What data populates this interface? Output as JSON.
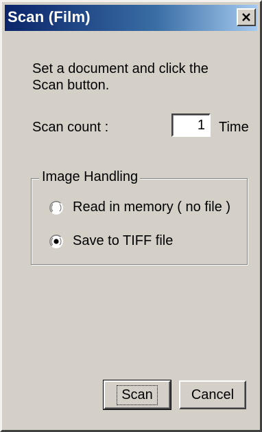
{
  "window": {
    "title": "Scan (Film)"
  },
  "dialog": {
    "instruction": "Set a document and click the Scan button.",
    "count_label": "Scan count :",
    "count_value": "1",
    "count_unit": "Time",
    "group_title": "Image Handling",
    "options": [
      {
        "label": "Read in memory ( no file )",
        "selected": false
      },
      {
        "label": "Save to TIFF file",
        "selected": true
      }
    ]
  },
  "buttons": {
    "scan_label": "Scan",
    "cancel_label": "Cancel"
  },
  "icons": {
    "close": "close-icon",
    "radio": "radio-button"
  },
  "colors": {
    "title_start": "#0a246a",
    "title_end": "#a6caf0",
    "face": "#d4d0c8"
  }
}
